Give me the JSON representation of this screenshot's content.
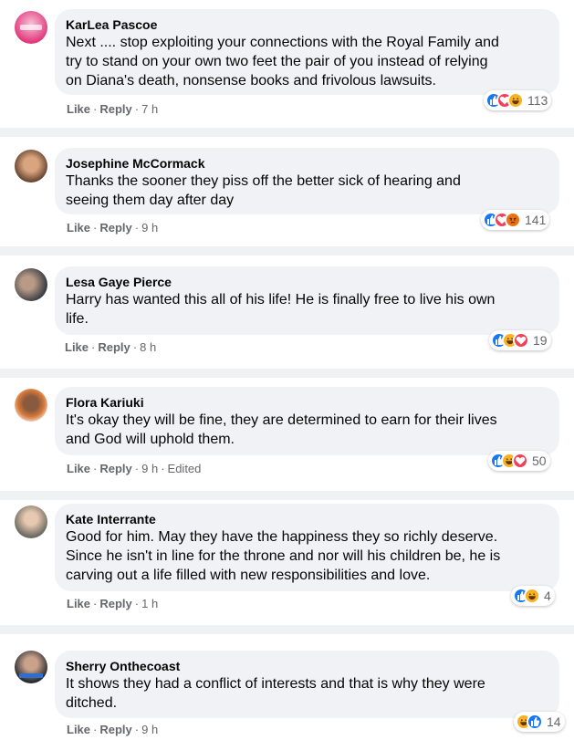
{
  "labels": {
    "like": "Like",
    "reply": "Reply",
    "dot": "·"
  },
  "colors": {
    "like": "#1877f2",
    "love": "#f33e58",
    "haha": "#f7b125",
    "angry": "#e9710f"
  },
  "comments": [
    {
      "author": "KarLea Pascoe",
      "text": "Next .... stop exploiting your connections with the Royal Family and\ntry to stand on your own two feet the pair of you instead of relying\non Diana's death, nonsense books and frivolous lawsuits.",
      "time": "7 h",
      "edited": "",
      "reactions": [
        "like-icon",
        "love-icon",
        "haha-icon"
      ],
      "count": "113"
    },
    {
      "author": "Josephine McCormack",
      "text": "Thanks the sooner they piss off the better sick of hearing and\nseeing them day after day",
      "time": "9 h",
      "edited": "",
      "reactions": [
        "like-icon",
        "love-icon",
        "angry-icon"
      ],
      "count": "141"
    },
    {
      "author": "Lesa Gaye Pierce",
      "text": "Harry has wanted this all of his life! He is finally free to live his own\nlife.",
      "time": "8 h",
      "edited": "",
      "reactions": [
        "like-icon",
        "haha-icon",
        "love-icon"
      ],
      "count": "19"
    },
    {
      "author": "Flora Kariuki",
      "text": "It's okay they will be fine, they are determined to earn for their lives\nand God will uphold them.",
      "time": "9 h",
      "edited": "Edited",
      "reactions": [
        "like-icon",
        "haha-icon",
        "love-icon"
      ],
      "count": "50"
    },
    {
      "author": "Kate Interrante",
      "text": "Good for him. May they have the happiness they so richly deserve.\nSince he isn't in line for the throne and nor will his children be, he is\ncarving out a life filled with new responsibilities and love.",
      "time": "1 h",
      "edited": "",
      "reactions": [
        "like-icon",
        "haha-icon"
      ],
      "count": "4"
    },
    {
      "author": "Sherry Onthecoast",
      "text": "It shows they had a conflict of interests and that is why they were\nditched.",
      "time": "9 h",
      "edited": "",
      "reactions": [
        "haha-icon",
        "like-icon"
      ],
      "count": "14"
    }
  ]
}
